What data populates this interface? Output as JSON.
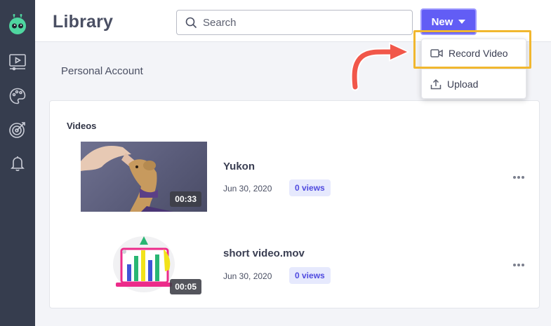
{
  "header": {
    "title": "Library",
    "search_placeholder": "Search",
    "new_label": "New"
  },
  "account": {
    "title": "Personal Account"
  },
  "library": {
    "section_title": "Videos",
    "videos": [
      {
        "title": "Yukon",
        "date": "Jun 30, 2020",
        "views": "0 views",
        "duration": "00:33"
      },
      {
        "title": "short video.mov",
        "date": "Jun 30, 2020",
        "views": "0 views",
        "duration": "00:05"
      }
    ]
  },
  "new_menu": {
    "items": [
      {
        "label": "Record Video",
        "icon": "video-camera-icon"
      },
      {
        "label": "Upload",
        "icon": "upload-icon"
      }
    ]
  },
  "sidebar": {
    "items": [
      {
        "icon": "robot-logo-icon"
      },
      {
        "icon": "video-player-icon"
      },
      {
        "icon": "palette-icon"
      },
      {
        "icon": "target-icon"
      },
      {
        "icon": "bell-icon"
      }
    ]
  },
  "colors": {
    "sidebar_bg": "#363d4e",
    "accent": "#625df5",
    "highlight": "#f1b72f",
    "arrow": "#f1574a",
    "logo_green": "#4fd6a0"
  }
}
